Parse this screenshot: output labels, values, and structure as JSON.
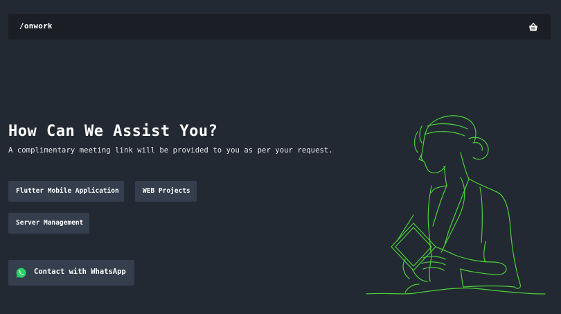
{
  "header": {
    "brand": "/onwork",
    "cart_icon": "basket-icon"
  },
  "hero": {
    "title": "How Can We Assist You?",
    "subtitle": "A complimentary meeting link will be provided to you as per your request."
  },
  "services": [
    {
      "label": "Flutter Mobile Application"
    },
    {
      "label": "WEB Projects"
    },
    {
      "label": "Server Management"
    }
  ],
  "contact": {
    "label": "Contact with WhatsApp",
    "icon": "whatsapp-icon"
  },
  "colors": {
    "background": "#222933",
    "navbar": "#1b1f25",
    "chip": "#343e4c",
    "illustration_line": "#4cd137",
    "whatsapp": "#25d366"
  }
}
